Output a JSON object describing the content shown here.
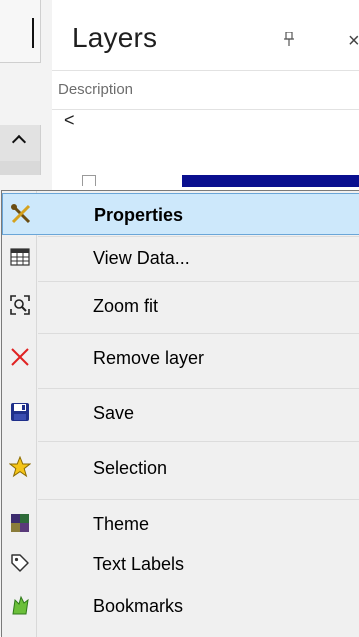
{
  "panel": {
    "title": "Layers",
    "pin_icon": "pin-icon",
    "close_symbol": "×",
    "column_header": "Description",
    "scroll_left_symbol": "<"
  },
  "menu": {
    "items": [
      {
        "label": "Properties",
        "icon": "wrench-screwdriver-icon",
        "bold": true,
        "highlighted": true
      },
      {
        "label": "View Data...",
        "icon": "table-icon"
      },
      {
        "label": "Zoom fit",
        "icon": "zoom-fit-icon"
      },
      {
        "label": "Remove layer",
        "icon": "red-x-icon"
      },
      {
        "label": "Save",
        "icon": "floppy-disk-icon"
      },
      {
        "label": "Selection",
        "icon": "star-icon"
      },
      {
        "label": "Theme",
        "icon": "theme-palette-icon"
      },
      {
        "label": "Text Labels",
        "icon": "tag-icon"
      },
      {
        "label": "Bookmarks",
        "icon": "bookmark-icon"
      }
    ]
  },
  "colors": {
    "highlight_bg": "#cde8fb",
    "highlight_border": "#6aa6d8",
    "selected_layer": "#0a0f8f"
  }
}
